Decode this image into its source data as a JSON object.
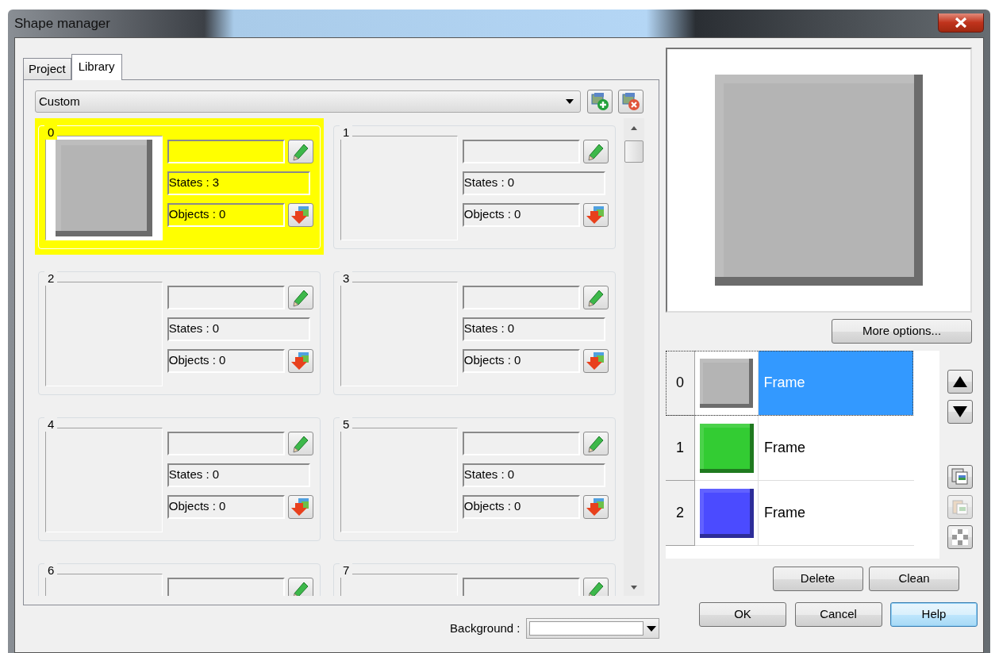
{
  "window": {
    "title": "Shape manager"
  },
  "tabs": [
    {
      "label": "Project",
      "selected": false
    },
    {
      "label": "Library",
      "selected": true
    }
  ],
  "library": {
    "value": "Custom"
  },
  "shapes": [
    {
      "index": "0",
      "selected": true,
      "has_preview": true,
      "states": "States : 3",
      "objects": "Objects : 0"
    },
    {
      "index": "1",
      "selected": false,
      "has_preview": false,
      "states": "States : 0",
      "objects": "Objects : 0"
    },
    {
      "index": "2",
      "selected": false,
      "has_preview": false,
      "states": "States : 0",
      "objects": "Objects : 0"
    },
    {
      "index": "3",
      "selected": false,
      "has_preview": false,
      "states": "States : 0",
      "objects": "Objects : 0"
    },
    {
      "index": "4",
      "selected": false,
      "has_preview": false,
      "states": "States : 0",
      "objects": "Objects : 0"
    },
    {
      "index": "5",
      "selected": false,
      "has_preview": false,
      "states": "States : 0",
      "objects": "Objects : 0"
    },
    {
      "index": "6",
      "selected": false,
      "has_preview": false
    },
    {
      "index": "7",
      "selected": false,
      "has_preview": false
    }
  ],
  "more_options": "More options...",
  "states": [
    {
      "index": "0",
      "name": "Frame",
      "color": "#b4b4b4",
      "selected": true
    },
    {
      "index": "1",
      "name": "Frame",
      "color": "#33cc33",
      "selected": false
    },
    {
      "index": "2",
      "name": "Frame",
      "color": "#4b4bff",
      "selected": false
    }
  ],
  "state_buttons": [
    "Delete",
    "Clean"
  ],
  "background": {
    "label": "Background :"
  },
  "dialog_buttons": [
    {
      "label": "OK",
      "default": false
    },
    {
      "label": "Cancel",
      "default": false
    },
    {
      "label": "Help",
      "default": true
    }
  ]
}
